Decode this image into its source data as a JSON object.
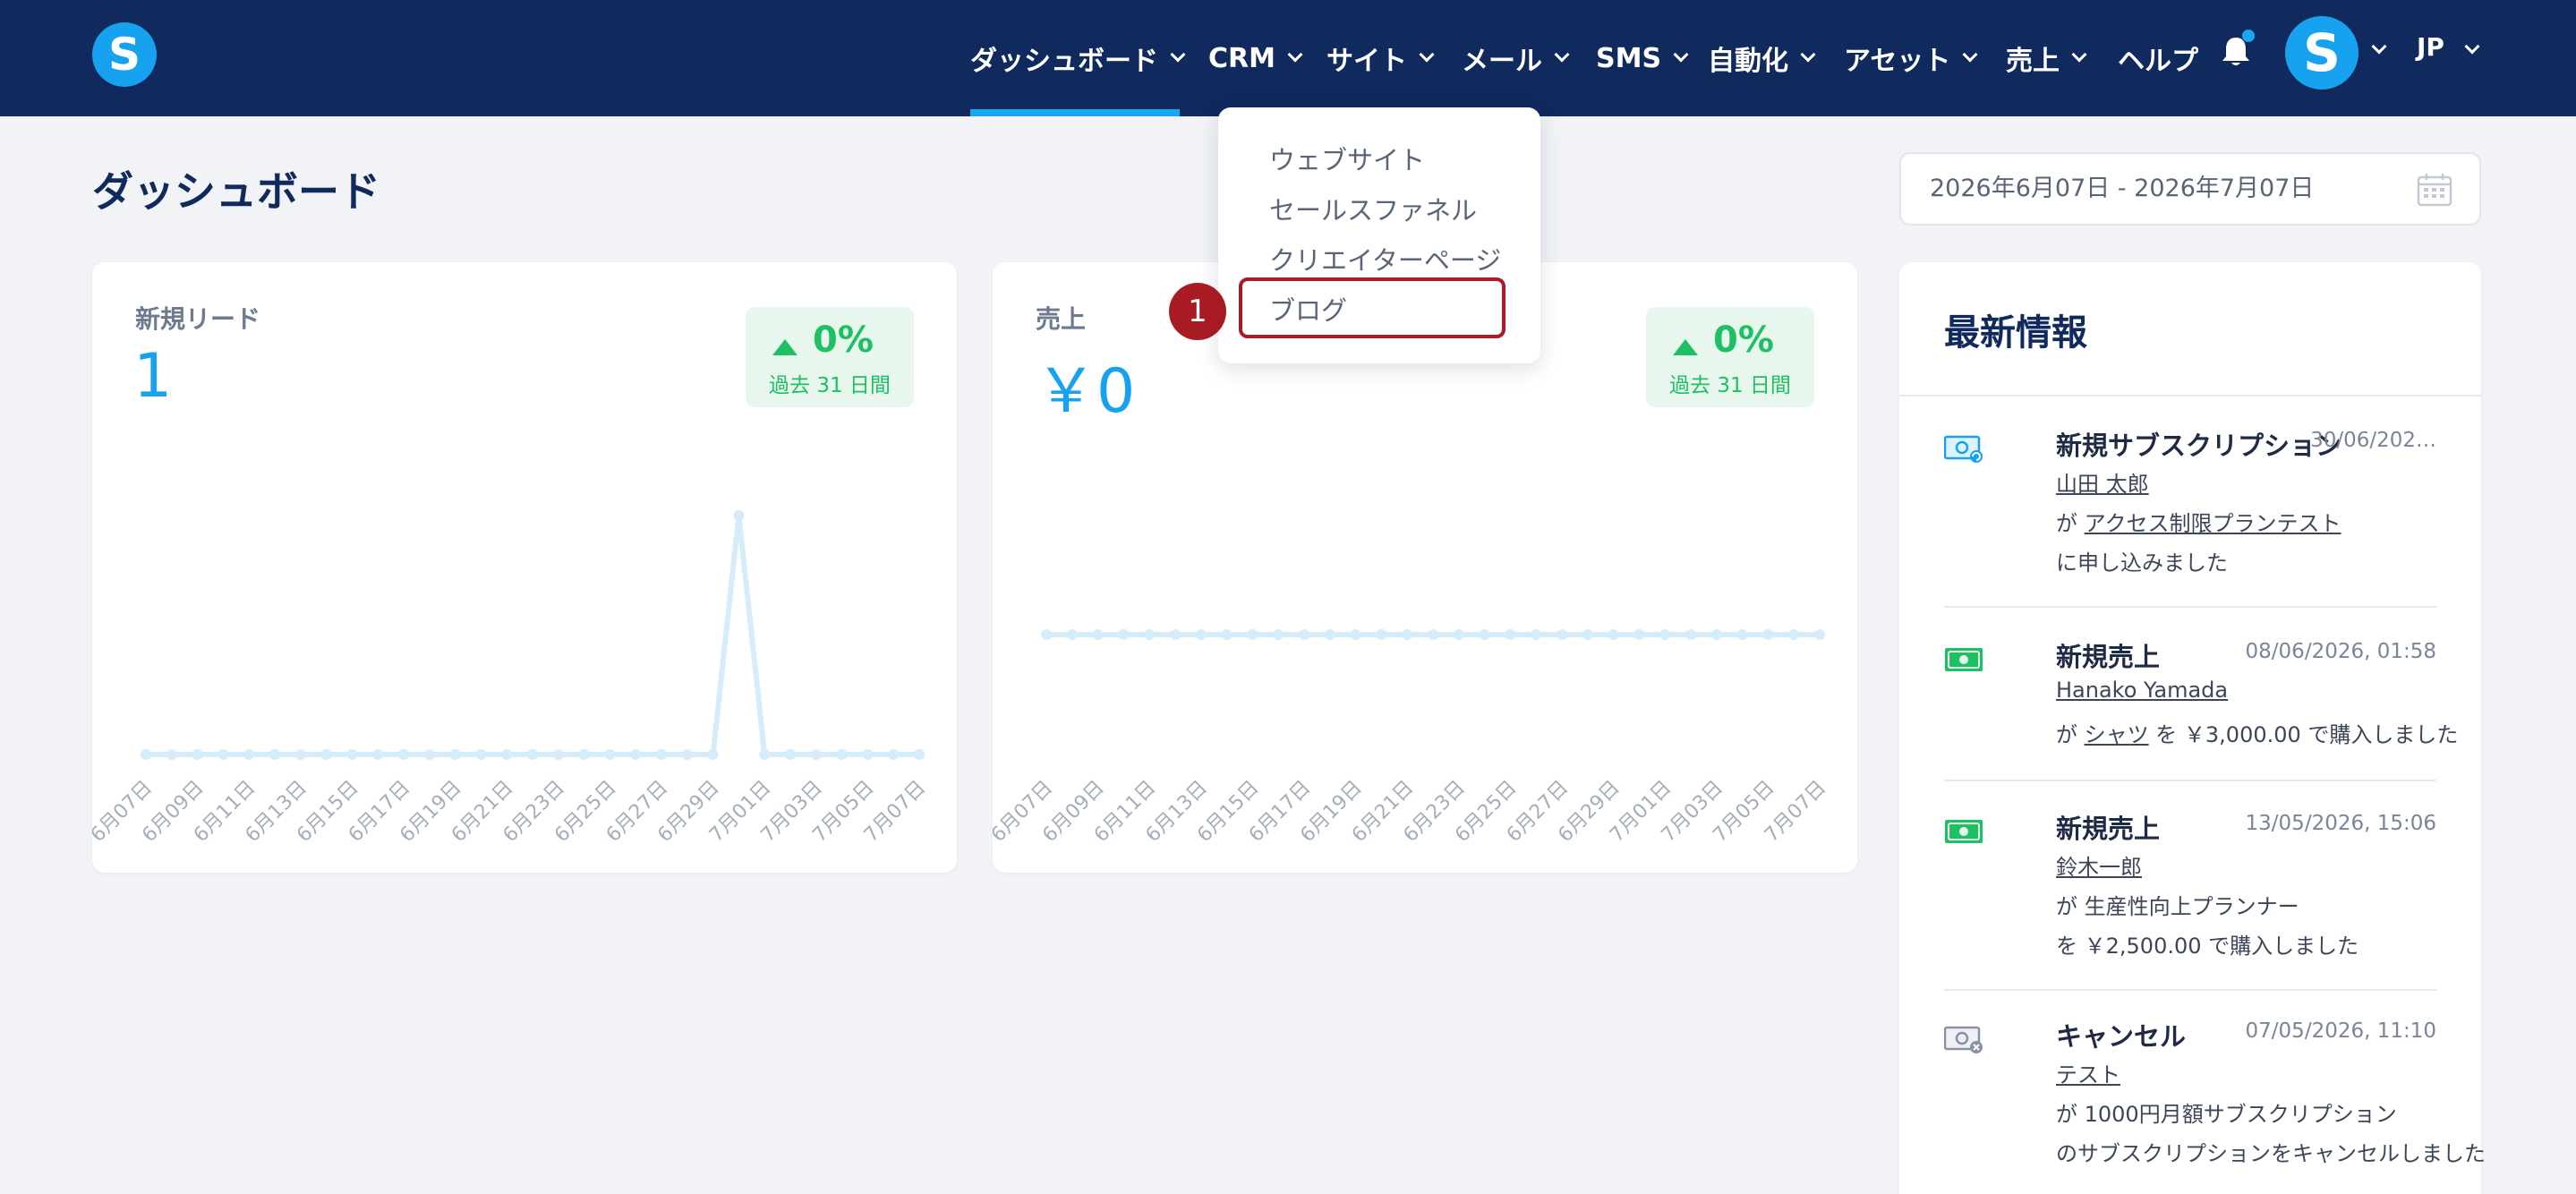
{
  "nav": {
    "logo": "S",
    "items": [
      {
        "label": "ダッシュボード"
      },
      {
        "label": "CRM"
      },
      {
        "label": "サイト"
      },
      {
        "label": "メール"
      },
      {
        "label": "SMS"
      },
      {
        "label": "自動化"
      },
      {
        "label": "アセット"
      },
      {
        "label": "売上"
      }
    ],
    "help": "ヘルプ",
    "avatar": "S",
    "lang": "JP",
    "accent": "#1aa6f2",
    "bg": "#112a5e",
    "active_item": "ダッシュボード"
  },
  "page": {
    "title": "ダッシュボード",
    "date_range": "2026年6月07日 - 2026年7月07日"
  },
  "site_dropdown": {
    "items": [
      {
        "label": "ウェブサイト"
      },
      {
        "label": "セールスファネル"
      },
      {
        "label": "クリエイターページ"
      },
      {
        "label": "ブログ"
      }
    ],
    "highlighted": "ブログ",
    "step_marker": "1"
  },
  "cards": {
    "leads": {
      "label": "新規リード",
      "value": "1",
      "change": "0%",
      "period": "過去 31 日間"
    },
    "sales": {
      "label": "売上",
      "value": "￥0",
      "change": "0%",
      "period": "過去 31 日間"
    }
  },
  "chart_data": [
    {
      "type": "line",
      "x": [
        "6月07日",
        "6月08日",
        "6月09日",
        "6月10日",
        "6月11日",
        "6月12日",
        "6月13日",
        "6月14日",
        "6月15日",
        "6月16日",
        "6月17日",
        "6月18日",
        "6月19日",
        "6月20日",
        "6月21日",
        "6月22日",
        "6月23日",
        "6月24日",
        "6月25日",
        "6月26日",
        "6月27日",
        "6月28日",
        "6月29日",
        "6月30日",
        "7月01日",
        "7月02日",
        "7月03日",
        "7月04日",
        "7月05日",
        "7月06日",
        "7月07日"
      ],
      "tick_labels": [
        "6月07日",
        "6月09日",
        "6月11日",
        "6月13日",
        "6月15日",
        "6月17日",
        "6月19日",
        "6月21日",
        "6月23日",
        "6月25日",
        "6月27日",
        "6月29日",
        "7月01日",
        "7月03日",
        "7月05日",
        "7月07日"
      ],
      "series": [
        {
          "values": [
            0,
            0,
            0,
            0,
            0,
            0,
            0,
            0,
            0,
            0,
            0,
            0,
            0,
            0,
            0,
            0,
            0,
            0,
            0,
            0,
            0,
            0,
            0,
            1,
            0,
            0,
            0,
            0,
            0,
            0,
            0
          ]
        }
      ],
      "ylim": [
        0,
        1
      ],
      "color": "#d6ecfb"
    },
    {
      "type": "line",
      "x": [
        "6月07日",
        "6月08日",
        "6月09日",
        "6月10日",
        "6月11日",
        "6月12日",
        "6月13日",
        "6月14日",
        "6月15日",
        "6月16日",
        "6月17日",
        "6月18日",
        "6月19日",
        "6月20日",
        "6月21日",
        "6月22日",
        "6月23日",
        "6月24日",
        "6月25日",
        "6月26日",
        "6月27日",
        "6月28日",
        "6月29日",
        "6月30日",
        "7月01日",
        "7月02日",
        "7月03日",
        "7月04日",
        "7月05日",
        "7月06日",
        "7月07日"
      ],
      "tick_labels": [
        "6月07日",
        "6月09日",
        "6月11日",
        "6月13日",
        "6月15日",
        "6月17日",
        "6月19日",
        "6月21日",
        "6月23日",
        "6月25日",
        "6月27日",
        "6月29日",
        "7月01日",
        "7月03日",
        "7月05日",
        "7月07日"
      ],
      "series": [
        {
          "values": [
            0,
            0,
            0,
            0,
            0,
            0,
            0,
            0,
            0,
            0,
            0,
            0,
            0,
            0,
            0,
            0,
            0,
            0,
            0,
            0,
            0,
            0,
            0,
            0,
            0,
            0,
            0,
            0,
            0,
            0,
            0
          ]
        }
      ],
      "color": "#d6ecfb"
    }
  ],
  "news": {
    "title": "最新情報",
    "items": [
      {
        "icon": "subscription-money-icon",
        "title": "新規サブスクリプション",
        "date": "30/06/202…",
        "person": "山田 太郎",
        "line2_prefix": "が",
        "line2_link": "アクセス制限プランテスト",
        "line3": "に申し込みました"
      },
      {
        "icon": "money-icon",
        "title": "新規売上",
        "date": "08/06/2026, 01:58",
        "person": "Hanako Yamada",
        "line2_prefix": "が",
        "line2_link": "シャツ",
        "line2_suffix": "を ￥3,000.00 で購入しました"
      },
      {
        "icon": "money-icon",
        "title": "新規売上",
        "date": "13/05/2026, 15:06",
        "person": "鈴木一郎",
        "line2": "が 生産性向上プランナー",
        "line3": "を ￥2,500.00 で購入しました"
      },
      {
        "icon": "cancel-money-icon",
        "title": "キャンセル",
        "date": "07/05/2026, 11:10",
        "person": "テスト",
        "line2": "が 1000円月額サブスクリプション",
        "line3": "のサブスクリプションをキャンセルしました"
      }
    ]
  }
}
